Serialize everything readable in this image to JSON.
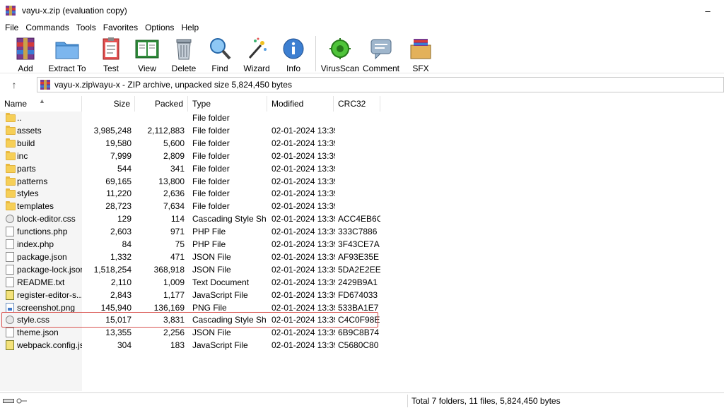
{
  "window": {
    "title": "vayu-x.zip (evaluation copy)",
    "minimize_icon": "minimize-icon",
    "maximize_icon": "maximize-icon",
    "close_icon": "close-icon"
  },
  "menu": [
    "File",
    "Commands",
    "Tools",
    "Favorites",
    "Options",
    "Help"
  ],
  "toolbar": {
    "buttons": [
      {
        "label": "Add",
        "icon": "add-archive-icon"
      },
      {
        "label": "Extract To",
        "icon": "extract-folder-icon"
      },
      {
        "label": "Test",
        "icon": "test-clipboard-icon"
      },
      {
        "label": "View",
        "icon": "view-book-icon"
      },
      {
        "label": "Delete",
        "icon": "trash-icon"
      },
      {
        "label": "Find",
        "icon": "magnifier-icon"
      },
      {
        "label": "Wizard",
        "icon": "wand-icon"
      },
      {
        "label": "Info",
        "icon": "info-icon"
      },
      {
        "label": "VirusScan",
        "icon": "virus-icon"
      },
      {
        "label": "Comment",
        "icon": "comment-icon"
      },
      {
        "label": "SFX",
        "icon": "sfx-box-icon"
      }
    ]
  },
  "address": {
    "up_icon": "up-arrow-icon",
    "path": "vayu-x.zip\\vayu-x - ZIP archive, unpacked size 5,824,450 bytes"
  },
  "columns": {
    "name": "Name",
    "size": "Size",
    "packed": "Packed",
    "type": "Type",
    "modified": "Modified",
    "crc": "CRC32"
  },
  "files": [
    {
      "name": "..",
      "size": "",
      "packed": "",
      "type": "File folder",
      "modified": "",
      "crc": "",
      "kind": "folder"
    },
    {
      "name": "assets",
      "size": "3,985,248",
      "packed": "2,112,883",
      "type": "File folder",
      "modified": "02-01-2024 13:39",
      "crc": "",
      "kind": "folder"
    },
    {
      "name": "build",
      "size": "19,580",
      "packed": "5,600",
      "type": "File folder",
      "modified": "02-01-2024 13:39",
      "crc": "",
      "kind": "folder"
    },
    {
      "name": "inc",
      "size": "7,999",
      "packed": "2,809",
      "type": "File folder",
      "modified": "02-01-2024 13:39",
      "crc": "",
      "kind": "folder"
    },
    {
      "name": "parts",
      "size": "544",
      "packed": "341",
      "type": "File folder",
      "modified": "02-01-2024 13:39",
      "crc": "",
      "kind": "folder"
    },
    {
      "name": "patterns",
      "size": "69,165",
      "packed": "13,800",
      "type": "File folder",
      "modified": "02-01-2024 13:39",
      "crc": "",
      "kind": "folder"
    },
    {
      "name": "styles",
      "size": "11,220",
      "packed": "2,636",
      "type": "File folder",
      "modified": "02-01-2024 13:39",
      "crc": "",
      "kind": "folder"
    },
    {
      "name": "templates",
      "size": "28,723",
      "packed": "7,634",
      "type": "File folder",
      "modified": "02-01-2024 13:39",
      "crc": "",
      "kind": "folder"
    },
    {
      "name": "block-editor.css",
      "size": "129",
      "packed": "114",
      "type": "Cascading Style Sh...",
      "modified": "02-01-2024 13:39",
      "crc": "ACC4EB6C",
      "kind": "css"
    },
    {
      "name": "functions.php",
      "size": "2,603",
      "packed": "971",
      "type": "PHP File",
      "modified": "02-01-2024 13:39",
      "crc": "333C7886",
      "kind": "doc"
    },
    {
      "name": "index.php",
      "size": "84",
      "packed": "75",
      "type": "PHP File",
      "modified": "02-01-2024 13:39",
      "crc": "3F43CE7A",
      "kind": "doc"
    },
    {
      "name": "package.json",
      "size": "1,332",
      "packed": "471",
      "type": "JSON File",
      "modified": "02-01-2024 13:39",
      "crc": "AF93E35E",
      "kind": "doc"
    },
    {
      "name": "package-lock.json",
      "size": "1,518,254",
      "packed": "368,918",
      "type": "JSON File",
      "modified": "02-01-2024 13:39",
      "crc": "5DA2E2EE",
      "kind": "doc"
    },
    {
      "name": "README.txt",
      "size": "2,110",
      "packed": "1,009",
      "type": "Text Document",
      "modified": "02-01-2024 13:39",
      "crc": "2429B9A1",
      "kind": "doc"
    },
    {
      "name": "register-editor-s...",
      "size": "2,843",
      "packed": "1,177",
      "type": "JavaScript File",
      "modified": "02-01-2024 13:39",
      "crc": "FD674033",
      "kind": "js"
    },
    {
      "name": "screenshot.png",
      "size": "145,940",
      "packed": "136,169",
      "type": "PNG File",
      "modified": "02-01-2024 13:39",
      "crc": "533BA1E7",
      "kind": "png"
    },
    {
      "name": "style.css",
      "size": "15,017",
      "packed": "3,831",
      "type": "Cascading Style Sh...",
      "modified": "02-01-2024 13:39",
      "crc": "C4C0F98E",
      "kind": "css"
    },
    {
      "name": "theme.json",
      "size": "13,355",
      "packed": "2,256",
      "type": "JSON File",
      "modified": "02-01-2024 13:39",
      "crc": "6B9C8B74",
      "kind": "doc"
    },
    {
      "name": "webpack.config.js",
      "size": "304",
      "packed": "183",
      "type": "JavaScript File",
      "modified": "02-01-2024 13:39",
      "crc": "C5680C80",
      "kind": "js"
    }
  ],
  "status": {
    "text": "Total 7 folders, 11 files, 5,824,450 bytes"
  },
  "colors": {
    "highlight": "#d9534f",
    "folder": "#f6cf57"
  }
}
